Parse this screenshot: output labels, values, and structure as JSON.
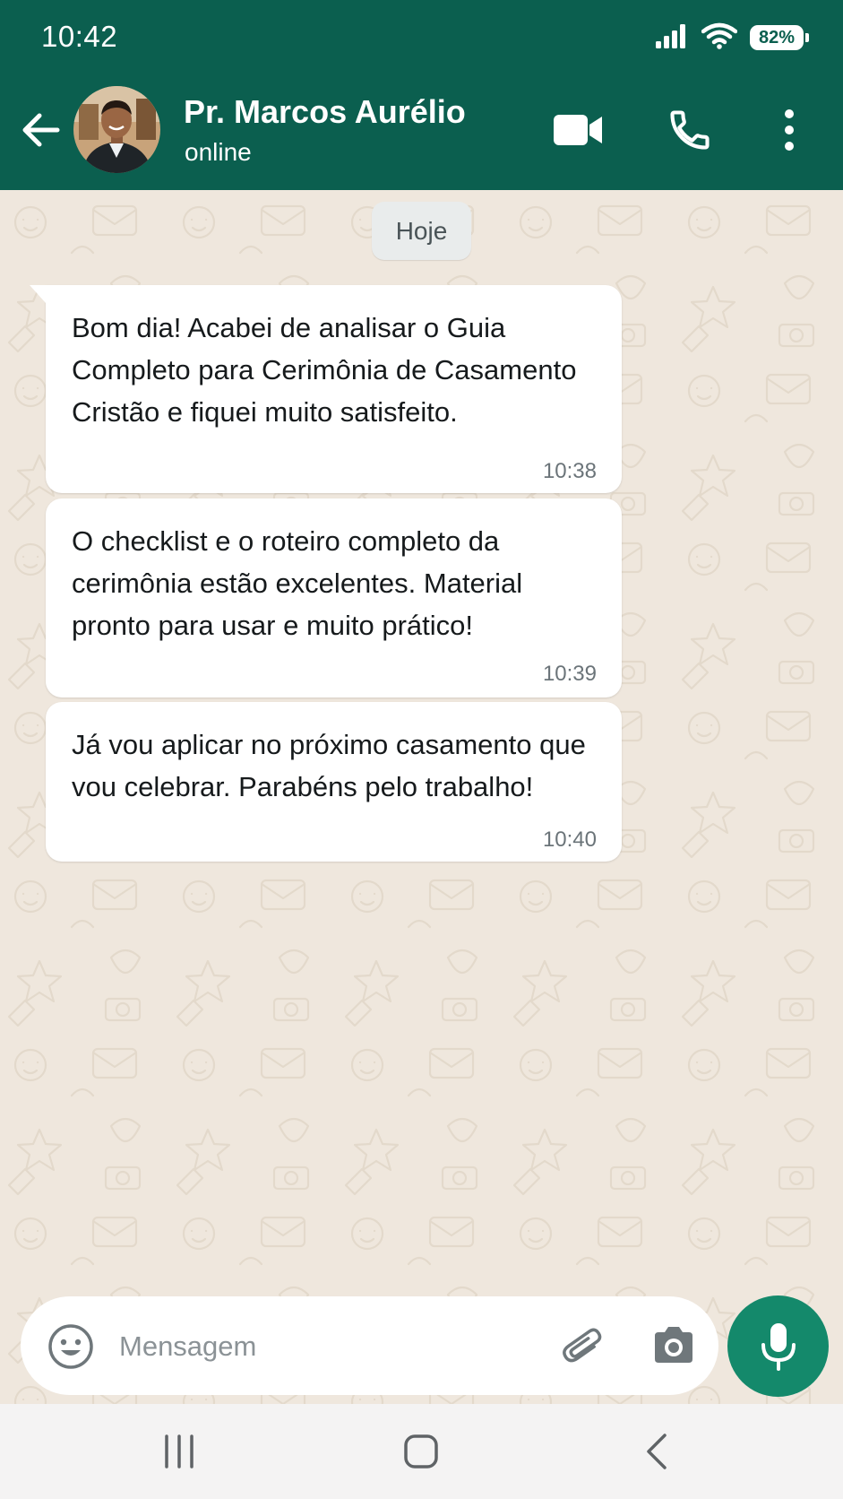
{
  "status_bar": {
    "time": "10:42",
    "battery": "82%",
    "icons": [
      "signal-icon",
      "wifi-icon",
      "battery-icon"
    ]
  },
  "header": {
    "contact_name": "Pr. Marcos Aurélio",
    "contact_status": "online",
    "icons": [
      "back-arrow-icon",
      "video-call-icon",
      "phone-icon",
      "more-vert-icon"
    ]
  },
  "chat": {
    "date_separator": "Hoje",
    "messages": [
      {
        "text": "Bom dia! Acabei de analisar o Guia Completo para Cerimônia de Casamento Cristão e fiquei muito satisfeito.",
        "time": "10:38",
        "direction": "incoming"
      },
      {
        "text": "O checklist e o roteiro completo da cerimônia estão excelentes. Material pronto para usar e muito prático!",
        "time": "10:39",
        "direction": "incoming"
      },
      {
        "text": "Já vou aplicar no próximo casamento que vou celebrar. Parabéns pelo trabalho!",
        "time": "10:40",
        "direction": "incoming"
      }
    ]
  },
  "composer": {
    "placeholder": "Mensagem",
    "value": "",
    "icons": [
      "emoji-icon",
      "attach-icon",
      "camera-icon",
      "mic-icon"
    ]
  },
  "navigation": {
    "icons": [
      "recents-icon",
      "home-icon",
      "back-icon"
    ]
  },
  "colors": {
    "header": "#0b5f4f",
    "chat_background": "#efe7dd",
    "bubble": "#ffffff",
    "mic_button": "#14896b",
    "nav_bar": "#f4f3f3"
  }
}
